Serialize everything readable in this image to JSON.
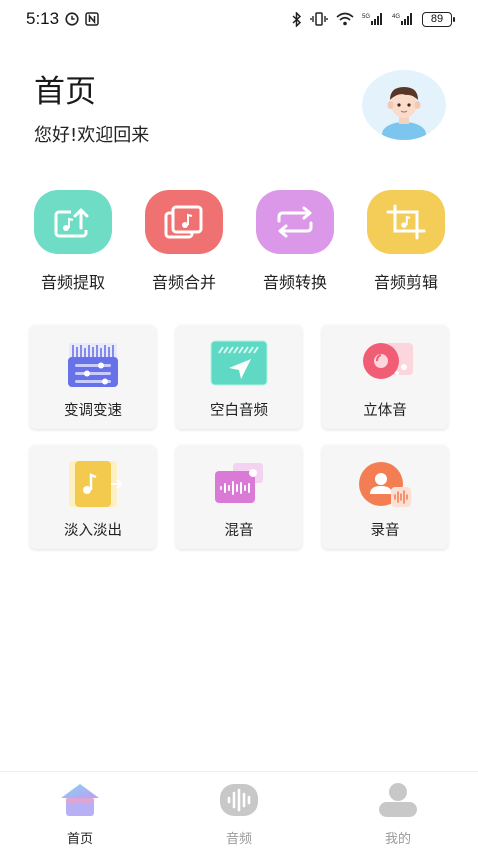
{
  "status_bar": {
    "time": "5:13",
    "battery": "89"
  },
  "header": {
    "title": "首页",
    "greeting": "您好!欢迎回来"
  },
  "quick_tools": [
    {
      "label": "音频提取",
      "color": "#6fdcc6",
      "icon": "audio-extract-icon"
    },
    {
      "label": "音频合并",
      "color": "#f07171",
      "icon": "audio-merge-icon"
    },
    {
      "label": "音频转换",
      "color": "#dc98e8",
      "icon": "audio-convert-icon"
    },
    {
      "label": "音频剪辑",
      "color": "#f3cd57",
      "icon": "audio-crop-icon"
    }
  ],
  "features": [
    {
      "label": "变调变速",
      "icon": "pitch-speed-icon"
    },
    {
      "label": "空白音频",
      "icon": "blank-audio-icon"
    },
    {
      "label": "立体音",
      "icon": "stereo-icon"
    },
    {
      "label": "淡入淡出",
      "icon": "fade-icon"
    },
    {
      "label": "混音",
      "icon": "mix-icon"
    },
    {
      "label": "录音",
      "icon": "record-icon"
    }
  ],
  "bottom_nav": [
    {
      "label": "首页",
      "active": true,
      "icon": "home-icon"
    },
    {
      "label": "音频",
      "active": false,
      "icon": "audio-icon"
    },
    {
      "label": "我的",
      "active": false,
      "icon": "profile-icon"
    }
  ],
  "colors": {
    "active_nav": "#222222",
    "inactive_nav": "#9a9a9a"
  }
}
